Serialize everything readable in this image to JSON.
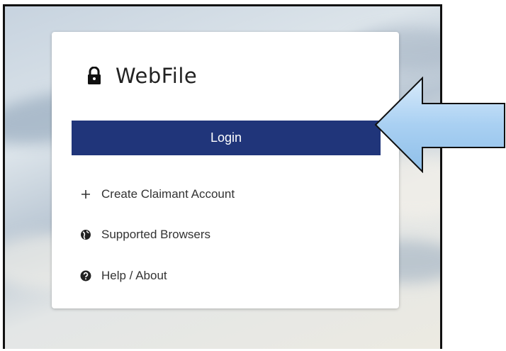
{
  "brand": {
    "title": "WebFile",
    "icon": "lock-icon"
  },
  "login": {
    "label": "Login",
    "color": "#20357a"
  },
  "links": [
    {
      "label": "Create Claimant Account",
      "icon": "plus-icon"
    },
    {
      "label": "Supported Browsers",
      "icon": "globe-icon"
    },
    {
      "label": "Help / About",
      "icon": "question-circle-icon"
    }
  ],
  "annotation": {
    "icon": "left-arrow-icon",
    "color": "#a9d0f2"
  }
}
